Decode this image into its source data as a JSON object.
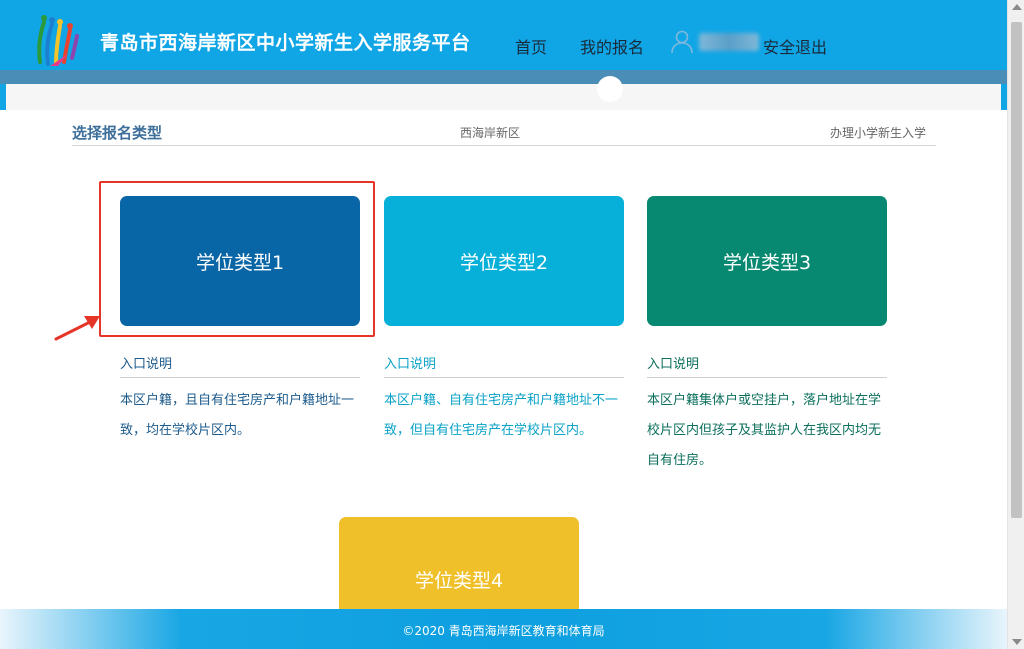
{
  "header": {
    "site_title": "青岛市西海岸新区中小学新生入学服务平台",
    "nav": [
      {
        "label": "首页"
      },
      {
        "label": "我的报名"
      }
    ],
    "logout_label": "安全退出",
    "user_icon": "user-icon",
    "colors": {
      "bar": "#10a6e6",
      "subbar": "#4a8db7"
    }
  },
  "section": {
    "title": "选择报名类型",
    "district": "西海岸新区",
    "action": "办理小学新生入学"
  },
  "cards": [
    {
      "label": "学位类型1",
      "color": "#0865a6"
    },
    {
      "label": "学位类型2",
      "color": "#07b0d8"
    },
    {
      "label": "学位类型3",
      "color": "#078870"
    },
    {
      "label": "学位类型4",
      "color": "#f0c02b"
    }
  ],
  "descriptions": [
    {
      "title": "入口说明",
      "text": "本区户籍，且自有住宅房产和户籍地址一致，均在学校片区内。"
    },
    {
      "title": "入口说明",
      "text": "本区户籍、自有住宅房产和户籍地址不一致，但自有住宅房产在学校片区内。"
    },
    {
      "title": "入口说明",
      "text": "本区户籍集体户或空挂户，落户地址在学校片区内但孩子及其监护人在我区内均无自有住房。"
    }
  ],
  "footer": {
    "copyright": "©2020 青岛西海岸新区教育和体育局"
  }
}
